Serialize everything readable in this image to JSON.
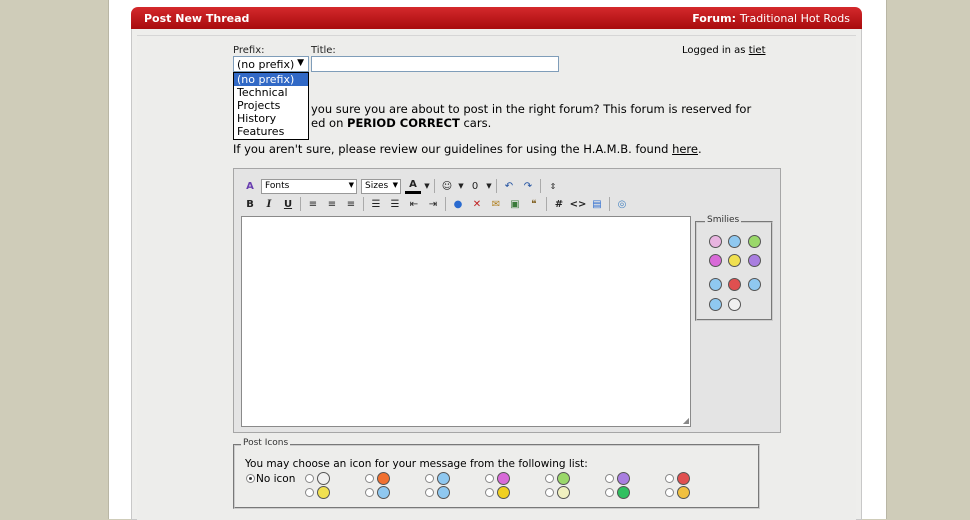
{
  "header": {
    "title": "Post New Thread",
    "forum_label": "Forum:",
    "forum_name": "Traditional Hot Rods"
  },
  "form": {
    "prefix_label": "Prefix:",
    "title_label": "Title:",
    "prefix_value": "(no prefix)",
    "prefix_options": [
      "(no prefix)",
      "Technical",
      "Projects",
      "History",
      "Features"
    ],
    "title_value": ""
  },
  "user": {
    "logged_in_text": "Logged in as",
    "username": "tiet"
  },
  "warning": {
    "line1": "you sure you are about to post in the right forum? This forum is reserved for",
    "line2_pre": "ed on",
    "line2_bold": "PERIOD CORRECT",
    "line2_post": "cars.",
    "line3_pre": "If you aren't sure, please review our guidelines for using the H.A.M.B. found",
    "line3_link": "here",
    "line3_post": "."
  },
  "editor": {
    "font_select": "Fonts",
    "size_select": "Sizes",
    "text_value": ""
  },
  "smilies": {
    "legend": "Smilies",
    "colors": [
      "#e8b4e0",
      "#8fc8f0",
      "#9ad86a",
      "#d86ad8",
      "#f0e050",
      "#a97ee0",
      "#8fc8f0",
      "#e05050",
      "#8fc8f0",
      "#8fc8f0",
      "#f0f0f0"
    ]
  },
  "post_icons": {
    "legend": "Post Icons",
    "instruction": "You may choose an icon for your message from the following list:",
    "no_icon_label": "No icon",
    "selected": "no-icon",
    "icon_colors": [
      "#f0f0f0",
      "#f07030",
      "#8fc8f0",
      "#d86ad8",
      "#9ad86a",
      "#a97ee0",
      "#e05050",
      "#f0e050",
      "#8fc8f0",
      "#8fc8f0",
      "#f0d020",
      "#f0f0c0",
      "#30c060",
      "#f0c040"
    ]
  },
  "colors": {
    "header_red": "#c0181b",
    "link_blue": "#3169c6"
  }
}
